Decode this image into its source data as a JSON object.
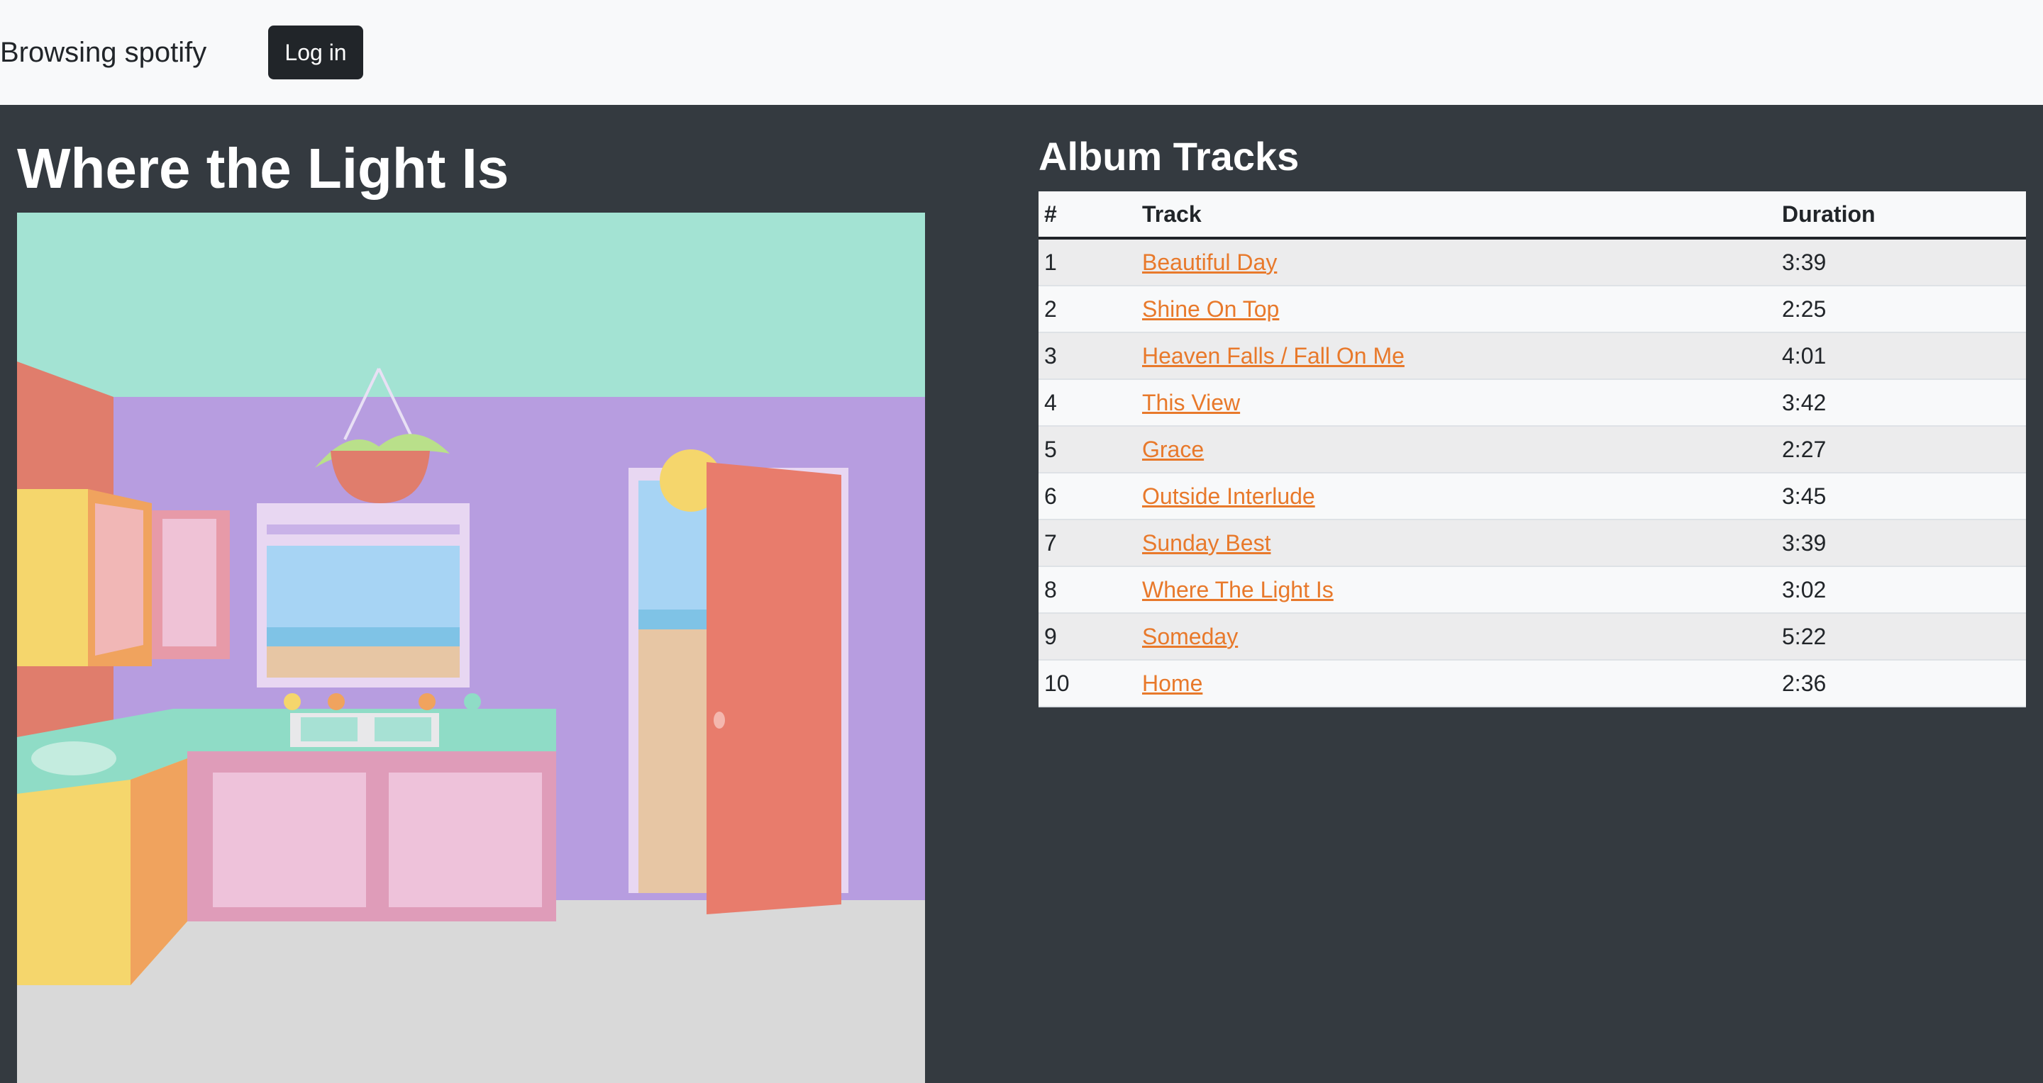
{
  "header": {
    "brand": "Browsing spotify",
    "login_label": "Log in"
  },
  "album": {
    "title": "Where the Light Is",
    "cover_alt": "Where the Light Is album cover"
  },
  "tracks": {
    "heading": "Album Tracks",
    "columns": [
      "#",
      "Track",
      "Duration"
    ],
    "rows": [
      {
        "num": "1",
        "name": "Beautiful Day",
        "duration": "3:39"
      },
      {
        "num": "2",
        "name": "Shine On Top",
        "duration": "2:25"
      },
      {
        "num": "3",
        "name": "Heaven Falls / Fall On Me",
        "duration": "4:01"
      },
      {
        "num": "4",
        "name": "This View",
        "duration": "3:42"
      },
      {
        "num": "5",
        "name": "Grace",
        "duration": "2:27"
      },
      {
        "num": "6",
        "name": "Outside Interlude",
        "duration": "3:45"
      },
      {
        "num": "7",
        "name": "Sunday Best",
        "duration": "3:39"
      },
      {
        "num": "8",
        "name": "Where The Light Is",
        "duration": "3:02"
      },
      {
        "num": "9",
        "name": "Someday",
        "duration": "5:22"
      },
      {
        "num": "10",
        "name": "Home",
        "duration": "2:36"
      }
    ]
  },
  "colors": {
    "navbar_bg": "#f8f9fa",
    "page_bg": "#343a40",
    "button_bg": "#212529",
    "link": "#e8792b"
  }
}
